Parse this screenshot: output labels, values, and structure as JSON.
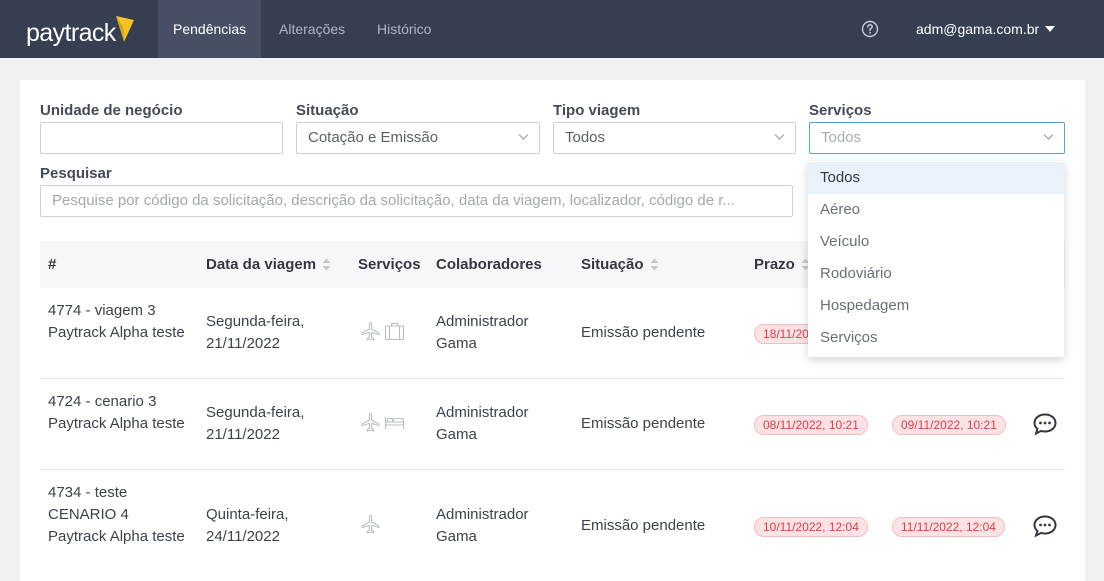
{
  "header": {
    "logo_text": "paytrack",
    "nav": [
      {
        "label": "Pendências",
        "active": true
      },
      {
        "label": "Alterações",
        "active": false
      },
      {
        "label": "Histórico",
        "active": false
      }
    ],
    "help_icon": "question-circle-icon",
    "user": "adm@gama.com.br"
  },
  "filters": {
    "unidade": {
      "label": "Unidade de negócio",
      "value": ""
    },
    "situacao": {
      "label": "Situação",
      "value": "Cotação e Emissão"
    },
    "tipo_viagem": {
      "label": "Tipo viagem",
      "value": "Todos"
    },
    "servicos": {
      "label": "Serviços",
      "placeholder": "Todos"
    },
    "pesquisar": {
      "label": "Pesquisar",
      "placeholder": "Pesquise por código da solicitação, descrição da solicitação, data da viagem, localizador, código de r..."
    }
  },
  "dropdown": {
    "options": [
      "Todos",
      "Aéreo",
      "Veículo",
      "Rodoviário",
      "Hospedagem",
      "Serviços"
    ],
    "selected": "Todos"
  },
  "table": {
    "columns": [
      "#",
      "Data da viagem",
      "Serviços",
      "Colaboradores",
      "Situação",
      "Prazo"
    ],
    "rows": [
      {
        "id": "4774 - viagem 3 Paytrack Alpha teste",
        "date": "Segunda-feira, 21/11/2022",
        "services": [
          "airplane-icon",
          "suitcase-icon"
        ],
        "collaborator": "Administrador Gama",
        "status": "Emissão pendente",
        "prazo": "18/11/20",
        "prazo2": ""
      },
      {
        "id": "4724 - cenario 3 Paytrack Alpha teste",
        "date": "Segunda-feira, 21/11/2022",
        "services": [
          "airplane-icon",
          "bed-icon"
        ],
        "collaborator": "Administrador Gama",
        "status": "Emissão pendente",
        "prazo": "08/11/2022, 10:21",
        "prazo2": "09/11/2022, 10:21"
      },
      {
        "id": "4734 - teste CENARIO 4 Paytrack Alpha teste",
        "date": "Quinta-feira, 24/11/2022",
        "services": [
          "airplane-icon"
        ],
        "collaborator": "Administrador Gama",
        "status": "Emissão pendente",
        "prazo": "10/11/2022, 12:04",
        "prazo2": "11/11/2022, 12:04"
      }
    ]
  },
  "colors": {
    "topbar": "#363e51",
    "active_nav": "#474f65",
    "accent_yellow": "#f5c324",
    "badge_text": "#d8414a",
    "badge_bg": "#fbe3e5"
  }
}
